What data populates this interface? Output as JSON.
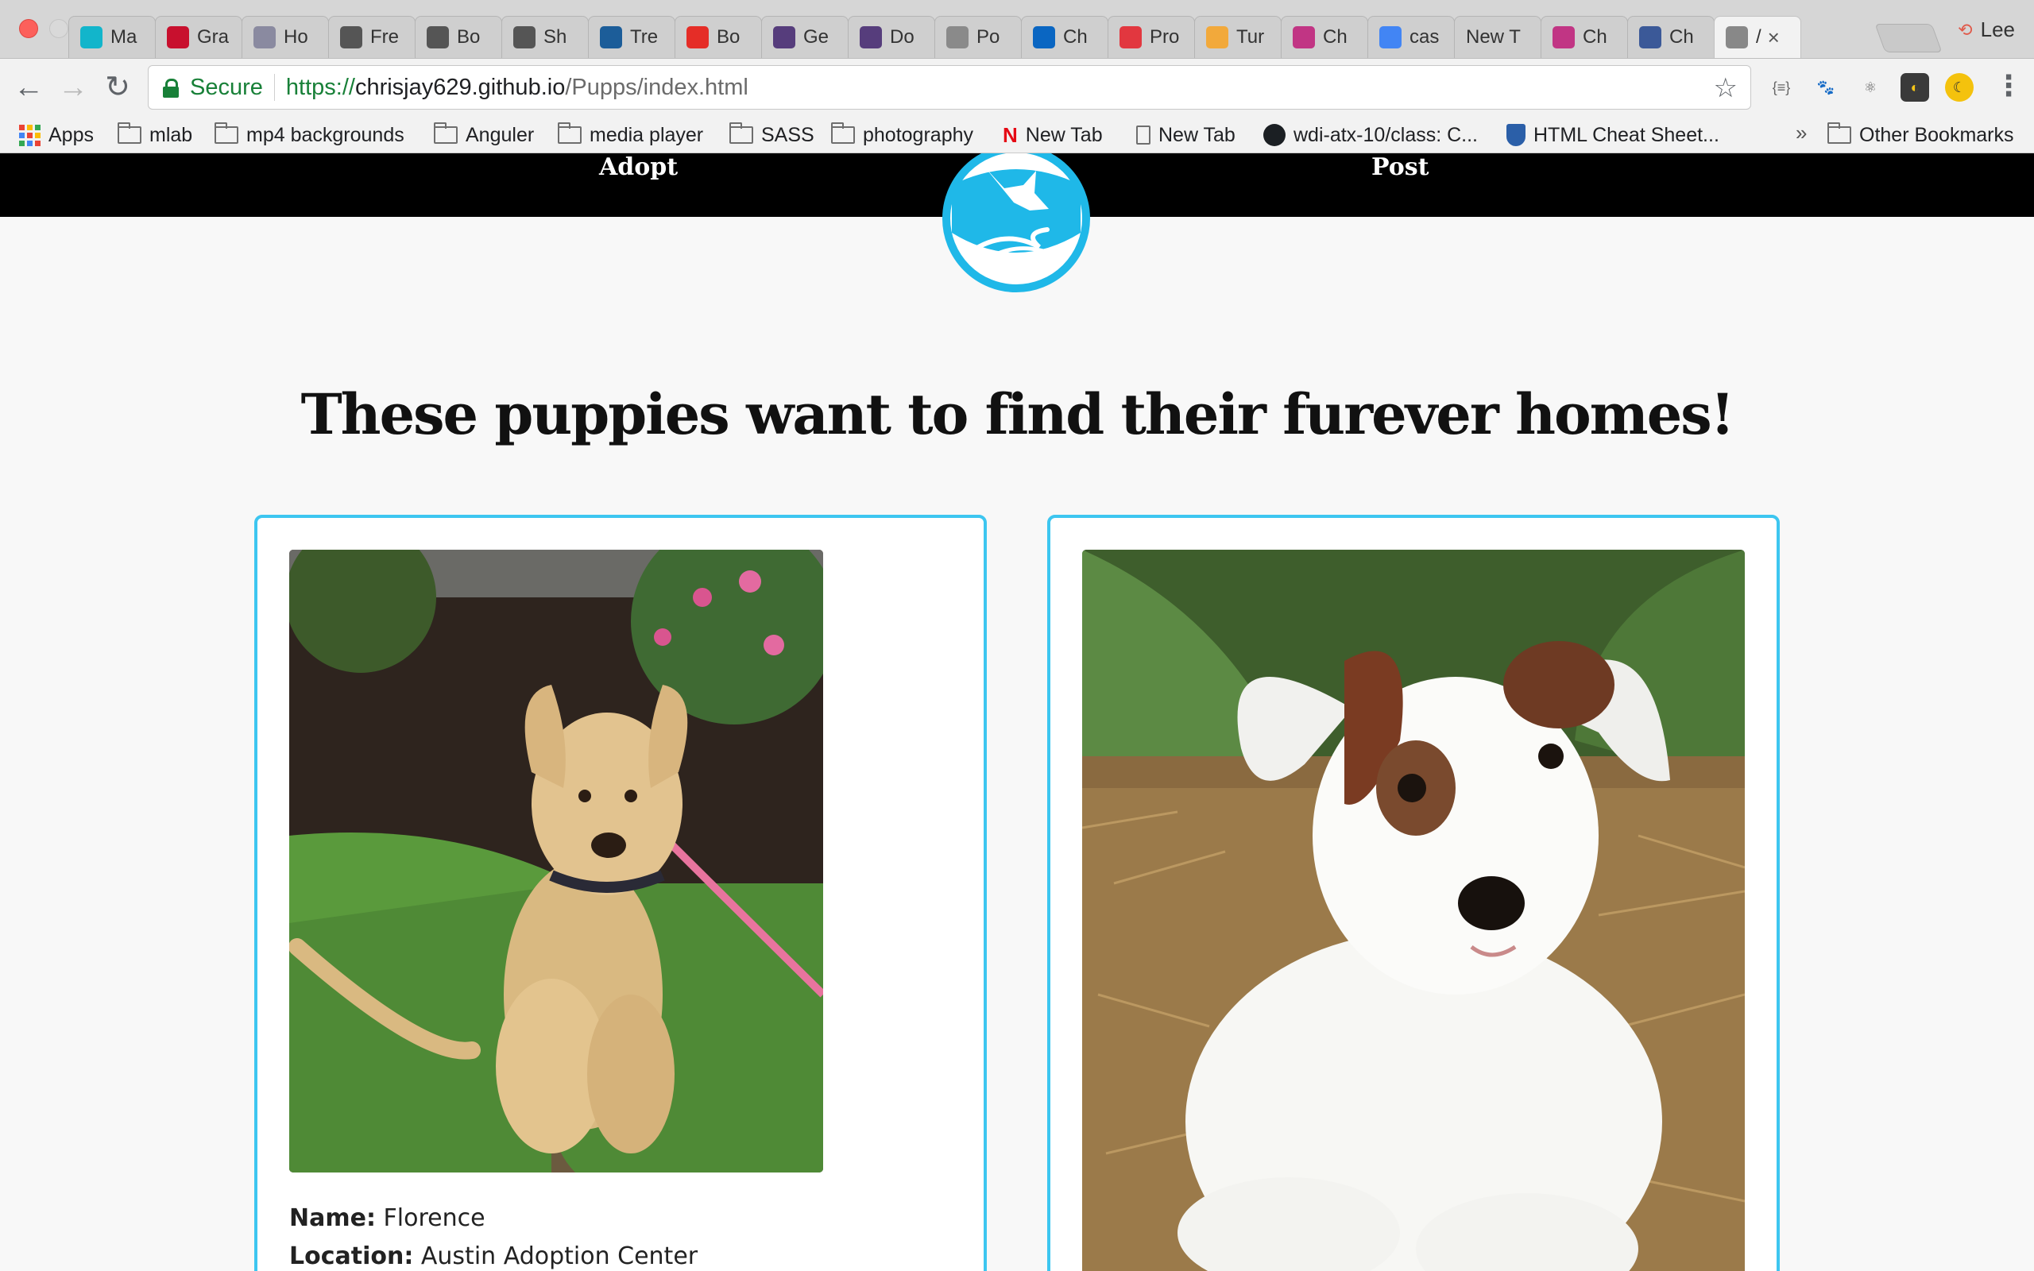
{
  "browser": {
    "tabs": [
      {
        "label": "Ma",
        "favicon": "circle-c-icon",
        "color": "#12b5cb"
      },
      {
        "label": "Gra",
        "favicon": "letter-v-icon",
        "color": "#c8102e"
      },
      {
        "label": "Ho",
        "favicon": "bolt-icon",
        "color": "#8a8aa0"
      },
      {
        "label": "Fre",
        "favicon": "robot-icon",
        "color": "#555555"
      },
      {
        "label": "Bo",
        "favicon": "robot-icon",
        "color": "#555555"
      },
      {
        "label": "Sh",
        "favicon": "robot-icon",
        "color": "#555555"
      },
      {
        "label": "Tre",
        "favicon": "compass-icon",
        "color": "#1c5d99"
      },
      {
        "label": "Bo",
        "favicon": "youtube-icon",
        "color": "#e52d27"
      },
      {
        "label": "Ge",
        "favicon": "bootstrap-icon",
        "color": "#563d7c"
      },
      {
        "label": "Do",
        "favicon": "bootstrap-icon",
        "color": "#563d7c"
      },
      {
        "label": "Po",
        "favicon": "face-icon",
        "color": "#8a8a8a"
      },
      {
        "label": "Ch",
        "favicon": "linkedin-icon",
        "color": "#0a66c2"
      },
      {
        "label": "Pro",
        "favicon": "ga-icon",
        "color": "#e2373f"
      },
      {
        "label": "Tur",
        "favicon": "pinwheel-icon",
        "color": "#f2a93b"
      },
      {
        "label": "Ch",
        "favicon": "instagram-icon",
        "color": "#c13584"
      },
      {
        "label": "cas",
        "favicon": "google-icon",
        "color": "#4285f4"
      },
      {
        "label": "New T",
        "favicon": "",
        "color": ""
      },
      {
        "label": "Ch",
        "favicon": "instagram-icon",
        "color": "#c13584"
      },
      {
        "label": "Ch",
        "favicon": "facebook-icon",
        "color": "#3b5998"
      },
      {
        "label": "/",
        "favicon": "document-icon",
        "color": "#888888"
      }
    ],
    "profile_name": "Lee",
    "secure_label": "Secure",
    "url_scheme": "https://",
    "url_host": "chrisjay629.github.io",
    "url_path": "/Pupps/index.html",
    "extensions": [
      "json-viewer-icon",
      "dog-icon",
      "react-icon",
      "photo-icon",
      "moon-icon"
    ],
    "bookmarks": [
      {
        "label": "Apps",
        "icon": "apps-grid-icon"
      },
      {
        "label": "mlab",
        "icon": "folder-icon"
      },
      {
        "label": "mp4 backgrounds",
        "icon": "folder-icon"
      },
      {
        "label": "Anguler",
        "icon": "folder-icon"
      },
      {
        "label": "media player",
        "icon": "folder-icon"
      },
      {
        "label": "SASS",
        "icon": "folder-icon"
      },
      {
        "label": "photography",
        "icon": "folder-icon"
      },
      {
        "label": "New Tab",
        "icon": "netflix-icon"
      },
      {
        "label": "New Tab",
        "icon": "document-icon"
      },
      {
        "label": "wdi-atx-10/class: C...",
        "icon": "github-icon"
      },
      {
        "label": "HTML Cheat Sheet...",
        "icon": "shield-icon"
      }
    ],
    "bookmarks_overflow": "»",
    "other_bookmarks": "Other Bookmarks"
  },
  "site": {
    "nav": {
      "adopt": "Adopt",
      "post": "Post"
    },
    "logo_color": "#1fb8e8",
    "headline": "These puppies want to find their furever homes!",
    "card_border_color": "#3dc6f0",
    "puppies": [
      {
        "name_label": "Name:",
        "name": "Florence",
        "location_label": "Location:",
        "location": "Austin Adoption Center"
      },
      {
        "name_label": "",
        "name": "",
        "location_label": "",
        "location": ""
      }
    ]
  }
}
